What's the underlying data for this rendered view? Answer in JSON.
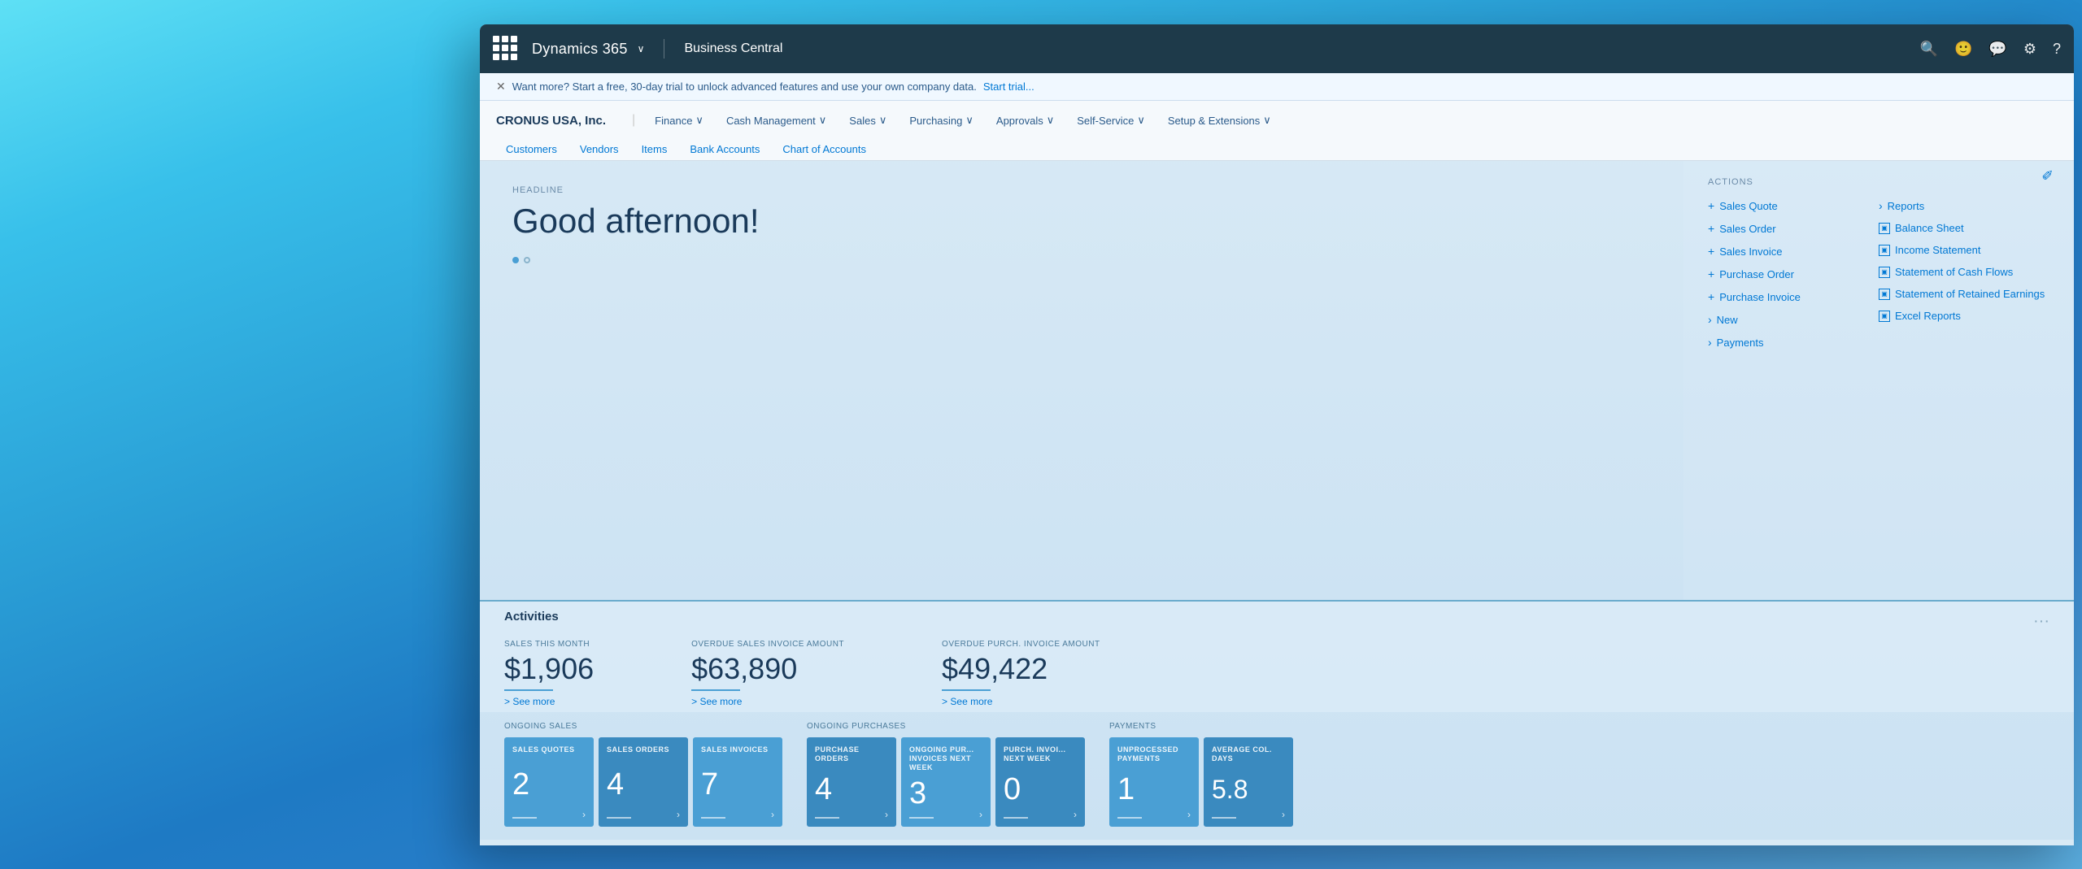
{
  "background": {
    "gradient_start": "#5ee0f5",
    "gradient_end": "#3080cc"
  },
  "titlebar": {
    "app_name": "Dynamics 365",
    "chevron": "∨",
    "app_subtitle": "Business Central",
    "icons": {
      "search": "🔍",
      "smiley": "🙂",
      "chat": "💬",
      "settings": "⚙",
      "help": "?"
    }
  },
  "banner": {
    "close": "✕",
    "text": "Want more? Start a free, 30-day trial to unlock advanced features and use your own company data.",
    "link_text": "Start trial..."
  },
  "navbar": {
    "company": "CRONUS USA, Inc.",
    "menu_items": [
      {
        "label": "Finance",
        "has_chevron": true
      },
      {
        "label": "Cash Management",
        "has_chevron": true
      },
      {
        "label": "Sales",
        "has_chevron": true
      },
      {
        "label": "Purchasing",
        "has_chevron": true
      },
      {
        "label": "Approvals",
        "has_chevron": true
      },
      {
        "label": "Self-Service",
        "has_chevron": true
      },
      {
        "label": "Setup & Extensions",
        "has_chevron": true
      }
    ],
    "secondary_items": [
      "Customers",
      "Vendors",
      "Items",
      "Bank Accounts",
      "Chart of Accounts"
    ]
  },
  "headline": {
    "label": "HEADLINE",
    "text": "Good afternoon!"
  },
  "actions": {
    "label": "ACTIONS",
    "left_col": [
      {
        "icon": "+",
        "label": "Sales Quote"
      },
      {
        "icon": "+",
        "label": "Sales Order"
      },
      {
        "icon": "+",
        "label": "Sales Invoice"
      },
      {
        "icon": "+",
        "label": "Purchase Order"
      },
      {
        "icon": "+",
        "label": "Purchase Invoice"
      },
      {
        "icon": ">",
        "label": "New"
      },
      {
        "icon": ">",
        "label": "Payments"
      }
    ],
    "right_col": [
      {
        "icon": "▶",
        "label": "Reports"
      },
      {
        "icon": "▣",
        "label": "Balance Sheet"
      },
      {
        "icon": "▣",
        "label": "Income Statement"
      },
      {
        "icon": "▣",
        "label": "Statement of Cash Flows"
      },
      {
        "icon": "▣",
        "label": "Statement of Retained Earnings"
      },
      {
        "icon": "▣",
        "label": "Excel Reports"
      }
    ]
  },
  "activities": {
    "section_label": "Activities",
    "items": [
      {
        "label": "SALES THIS MONTH",
        "amount": "$1,906",
        "see_more": "> See more"
      },
      {
        "label": "OVERDUE SALES INVOICE AMOUNT",
        "amount": "$63,890",
        "see_more": "> See more"
      },
      {
        "label": "OVERDUE PURCH. INVOICE AMOUNT",
        "amount": "$49,422",
        "see_more": "> See more"
      }
    ]
  },
  "ongoing_sales": {
    "group_label": "ONGOING SALES",
    "tiles": [
      {
        "label": "SALES QUOTES",
        "value": "2"
      },
      {
        "label": "SALES ORDERS",
        "value": "4"
      },
      {
        "label": "SALES INVOICES",
        "value": "7"
      }
    ]
  },
  "ongoing_purchases": {
    "group_label": "ONGOING PURCHASES",
    "tiles": [
      {
        "label": "PURCHASE ORDERS",
        "value": "4"
      },
      {
        "label": "ONGOING PUR... INVOICES NEXT WEEK",
        "value": "3"
      },
      {
        "label": "PURCH. INVOI... NEXT WEEK",
        "value": "0"
      }
    ]
  },
  "payments": {
    "group_label": "PAYMENTS",
    "tiles": [
      {
        "label": "UNPROCESSED PAYMENTS",
        "value": "1"
      },
      {
        "label": "AVERAGE COL. DAYS",
        "value": "5.8"
      }
    ]
  }
}
